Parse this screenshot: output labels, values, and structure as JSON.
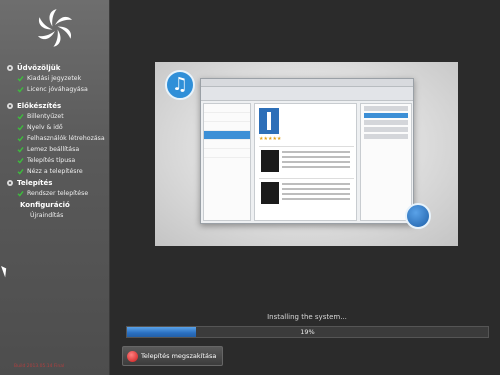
{
  "sidebar": {
    "sections": [
      {
        "label": "Üdvözöljük",
        "items": [
          {
            "label": "Kiadási jegyzetek",
            "done": true
          },
          {
            "label": "Licenc jóváhagyása",
            "done": true
          }
        ]
      },
      {
        "label": "Előkészítés",
        "items": [
          {
            "label": "Billentyűzet",
            "done": true
          },
          {
            "label": "Nyelv & idő",
            "done": true
          },
          {
            "label": "Felhasználók létrehozása",
            "done": true
          },
          {
            "label": "Lemez beállítása",
            "done": true
          },
          {
            "label": "Telepítés típusa",
            "done": true
          },
          {
            "label": "Nézz a telepítésre",
            "done": true
          }
        ]
      },
      {
        "label": "Telepítés",
        "items": [
          {
            "label": "Rendszer telepítése",
            "done": true
          },
          {
            "label": "Konfiguráció",
            "done": false,
            "current": true
          },
          {
            "label": "Újraindítás",
            "done": false
          }
        ]
      }
    ],
    "build_info": "Build 2013.05.14 Final"
  },
  "progress": {
    "status_text": "Installing the system...",
    "value": 0.19,
    "percent_label": "19%"
  },
  "cancel_button": {
    "label": "Telepítés megszakítása"
  },
  "colors": {
    "accent": "#2a6fc0",
    "sidebar_bg": "#5a5a5a",
    "window_bg": "#2b2b2b",
    "check_green": "#3dbd3d",
    "stop_red": "#c81818"
  },
  "icons": {
    "logo": "pinwheel-logo-icon",
    "music": "music-note-icon",
    "kde": "kde-badge-icon"
  }
}
